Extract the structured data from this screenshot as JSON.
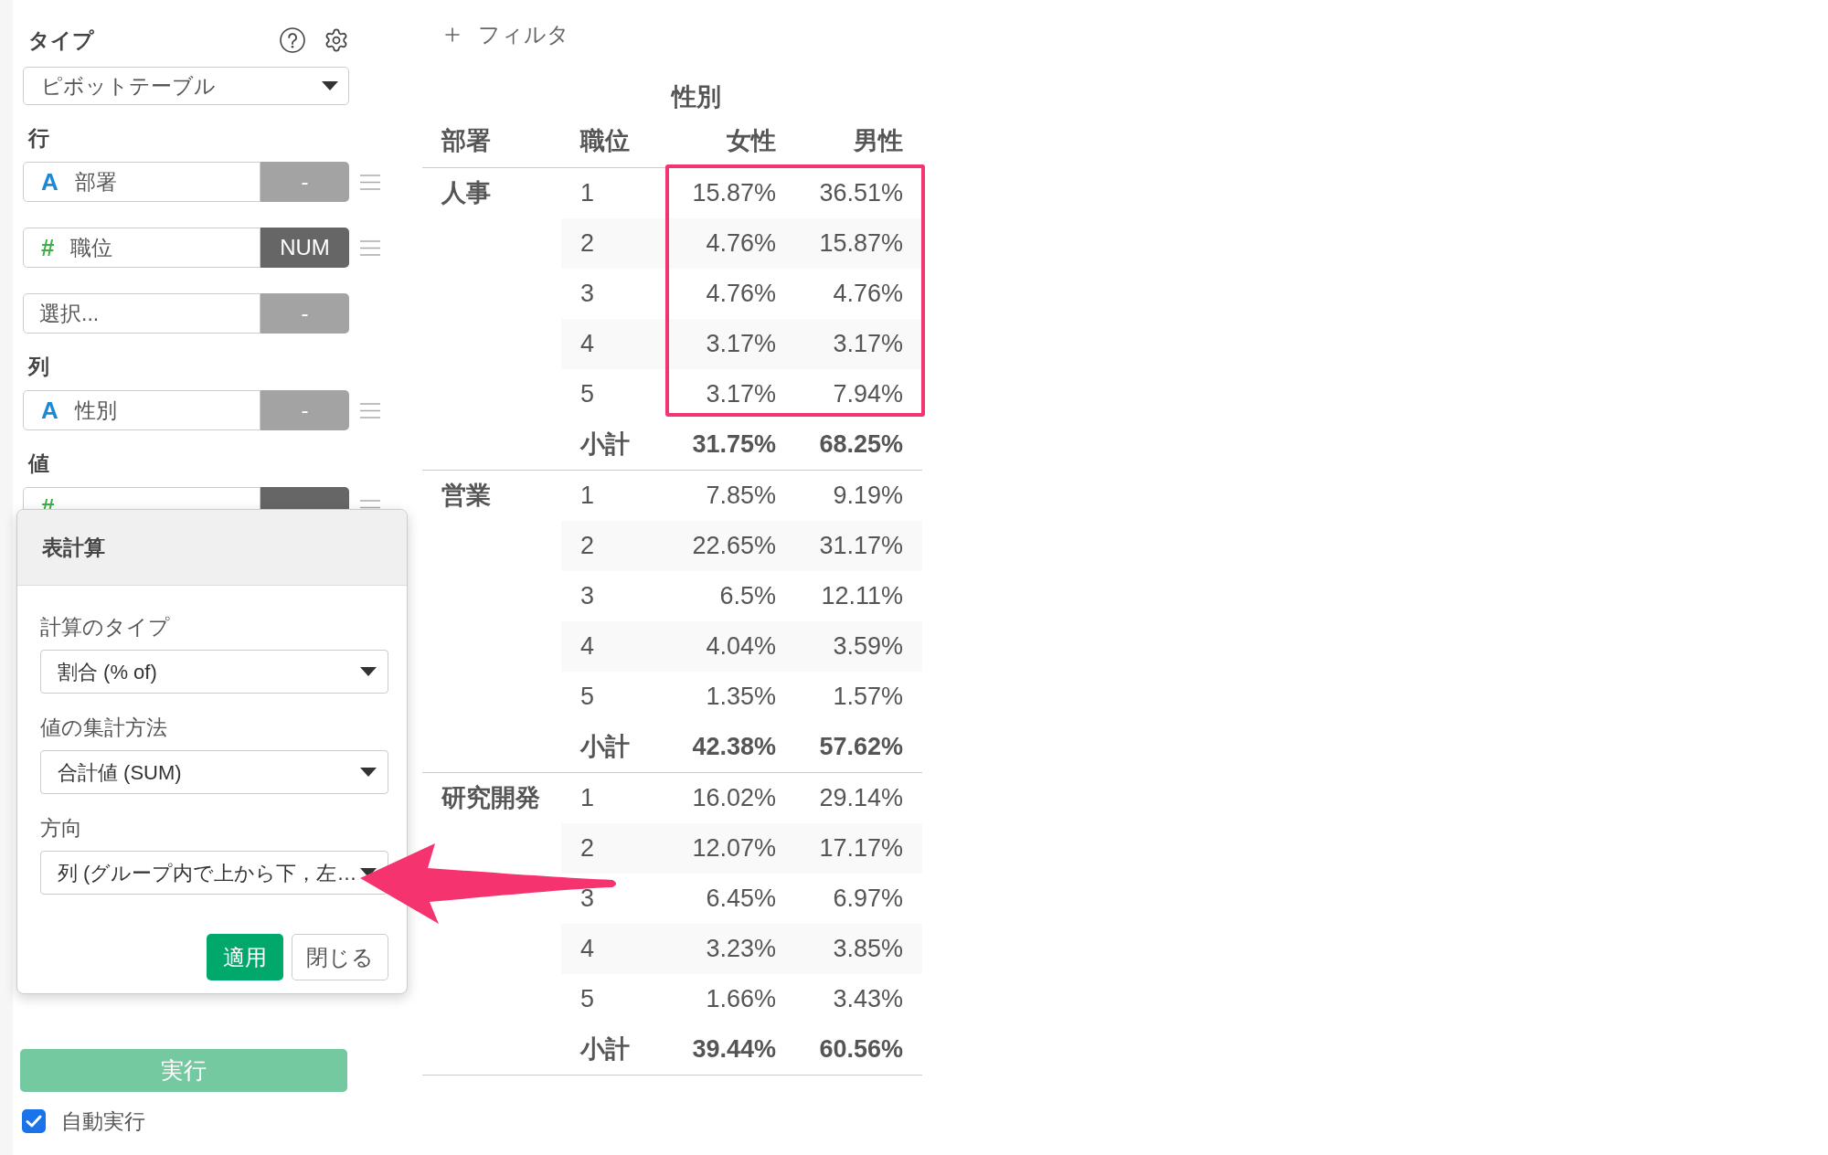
{
  "sidebar": {
    "type_label": "タイプ",
    "type_select": {
      "value": "ピボットテーブル"
    },
    "sections": [
      {
        "label": "行",
        "fields": [
          {
            "kind": "text",
            "icon": "A",
            "name": "部署",
            "function": "-",
            "active": false
          },
          {
            "kind": "number",
            "icon": "#",
            "name": "職位",
            "function": "NUM",
            "active": true
          },
          {
            "kind": "empty",
            "placeholder": "選択...",
            "function": "-",
            "active": false
          }
        ]
      },
      {
        "label": "列",
        "fields": [
          {
            "kind": "text",
            "icon": "A",
            "name": "性別",
            "function": "-",
            "active": false
          }
        ]
      },
      {
        "label": "値",
        "fields": [
          {
            "kind": "number",
            "icon": "#",
            "active": true
          }
        ]
      }
    ],
    "run_button": {
      "label": "実行",
      "disabled": true
    },
    "auto_run": {
      "label": "自動実行",
      "checked": true
    }
  },
  "popup": {
    "title": "表計算",
    "fields": [
      {
        "label": "計算のタイプ",
        "value": "割合 (% of)",
        "pointed": false
      },
      {
        "label": "値の集計方法",
        "value": "合計値 (SUM)",
        "pointed": false
      },
      {
        "label": "方向",
        "value": "列 (グループ内で上から下，左…",
        "pointed": true
      }
    ],
    "buttons": [
      {
        "label": "適用",
        "kind": "primary"
      },
      {
        "label": "閉じる",
        "kind": "secondary"
      }
    ]
  },
  "main": {
    "filter_label": "フィルタ",
    "table": {
      "column_group": "性別",
      "columns": [
        "部署",
        "職位",
        "女性",
        "男性"
      ],
      "groups": [
        {
          "name": "人事",
          "highlighted": true,
          "rows": [
            {
              "cells": [
                "1",
                "15.87%",
                "36.51%"
              ]
            },
            {
              "cells": [
                "2",
                "4.76%",
                "15.87%"
              ]
            },
            {
              "cells": [
                "3",
                "4.76%",
                "4.76%"
              ]
            },
            {
              "cells": [
                "4",
                "3.17%",
                "3.17%"
              ]
            },
            {
              "cells": [
                "5",
                "3.17%",
                "7.94%"
              ]
            }
          ],
          "subtotal": {
            "label": "小計",
            "values": [
              "31.75%",
              "68.25%"
            ]
          }
        },
        {
          "name": "営業",
          "highlighted": false,
          "rows": [
            {
              "cells": [
                "1",
                "7.85%",
                "9.19%"
              ]
            },
            {
              "cells": [
                "2",
                "22.65%",
                "31.17%"
              ]
            },
            {
              "cells": [
                "3",
                "6.5%",
                "12.11%"
              ]
            },
            {
              "cells": [
                "4",
                "4.04%",
                "3.59%"
              ]
            },
            {
              "cells": [
                "5",
                "1.35%",
                "1.57%"
              ]
            }
          ],
          "subtotal": {
            "label": "小計",
            "values": [
              "42.38%",
              "57.62%"
            ]
          }
        },
        {
          "name": "研究開発",
          "highlighted": false,
          "rows": [
            {
              "cells": [
                "1",
                "16.02%",
                "29.14%"
              ]
            },
            {
              "cells": [
                "2",
                "12.07%",
                "17.17%"
              ]
            },
            {
              "cells": [
                "3",
                "6.45%",
                "6.97%"
              ]
            },
            {
              "cells": [
                "4",
                "3.23%",
                "3.85%"
              ]
            },
            {
              "cells": [
                "5",
                "1.66%",
                "3.43%"
              ]
            }
          ],
          "subtotal": {
            "label": "小計",
            "values": [
              "39.44%",
              "60.56%"
            ]
          }
        }
      ]
    }
  }
}
